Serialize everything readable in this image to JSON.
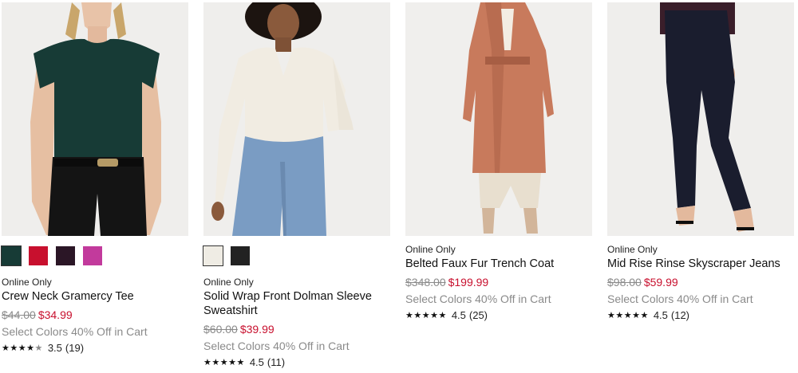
{
  "products": [
    {
      "badge": "",
      "name": "Crew Neck Gramercy Tee",
      "old_price": "$44.00",
      "sale_price": "$34.99",
      "promo": "Select Colors 40% Off in Cart",
      "rating": "3.5",
      "reviews": "(19)",
      "stars_filled": 4,
      "stars_empty": 1,
      "badge_below": "Online Only",
      "swatches": [
        "#173b36",
        "#c8102e",
        "#2b1626",
        "#c23a9c"
      ]
    },
    {
      "badge_below": "Online Only",
      "name": "Solid Wrap Front Dolman Sleeve Sweatshirt",
      "old_price": "$60.00",
      "sale_price": "$39.99",
      "promo": "Select Colors 40% Off in Cart",
      "rating": "4.5",
      "reviews": "(11)",
      "stars_filled": 5,
      "stars_empty": 0,
      "swatches": [
        "#efece4",
        "#222222"
      ]
    },
    {
      "badge_below": "Online Only",
      "name": "Belted Faux Fur Trench Coat",
      "old_price": "$348.00",
      "sale_price": "$199.99",
      "promo": "Select Colors 40% Off in Cart",
      "rating": "4.5",
      "reviews": "(25)",
      "stars_filled": 5,
      "stars_empty": 0,
      "swatches": []
    },
    {
      "badge_below": "Online Only",
      "name": "Mid Rise Rinse Skyscraper Jeans",
      "old_price": "$98.00",
      "sale_price": "$59.99",
      "promo": "Select Colors 40% Off in Cart",
      "rating": "4.5",
      "reviews": "(12)",
      "stars_filled": 5,
      "stars_empty": 0,
      "swatches": []
    }
  ],
  "colors": {
    "sale": "#c8102e",
    "muted": "#8a8a8a"
  }
}
